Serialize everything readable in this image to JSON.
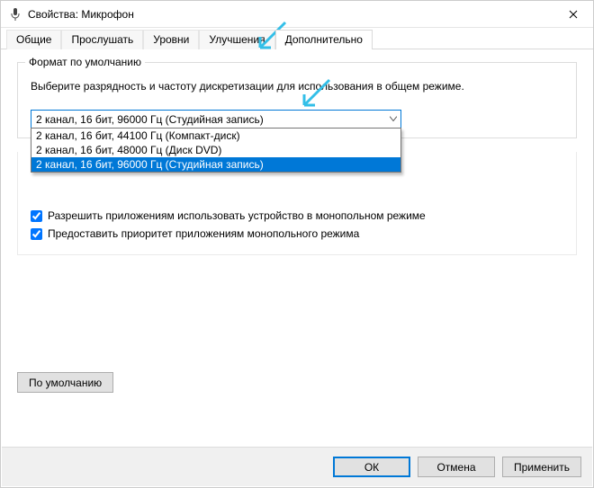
{
  "window": {
    "title": "Свойства: Микрофон"
  },
  "tabs": {
    "t0": "Общие",
    "t1": "Прослушать",
    "t2": "Уровни",
    "t3": "Улучшения",
    "t4": "Дополнительно"
  },
  "group": {
    "legend": "Формат по умолчанию",
    "desc": "Выберите разрядность и частоту дискретизации для использования в общем режиме."
  },
  "select": {
    "current": "2 канал, 16 бит, 96000 Гц (Студийная запись)",
    "options": {
      "o0": "2 канал, 16 бит, 44100 Гц (Компакт-диск)",
      "o1": "2 канал, 16 бит, 48000 Гц (Диск DVD)",
      "o2": "2 канал, 16 бит, 96000 Гц (Студийная запись)"
    }
  },
  "checks": {
    "c1": "Разрешить приложениям использовать устройство в монопольном режиме",
    "c2": "Предоставить приоритет приложениям монопольного режима"
  },
  "buttons": {
    "defaults": "По умолчанию",
    "ok": "ОК",
    "cancel": "Отмена",
    "apply": "Применить"
  }
}
